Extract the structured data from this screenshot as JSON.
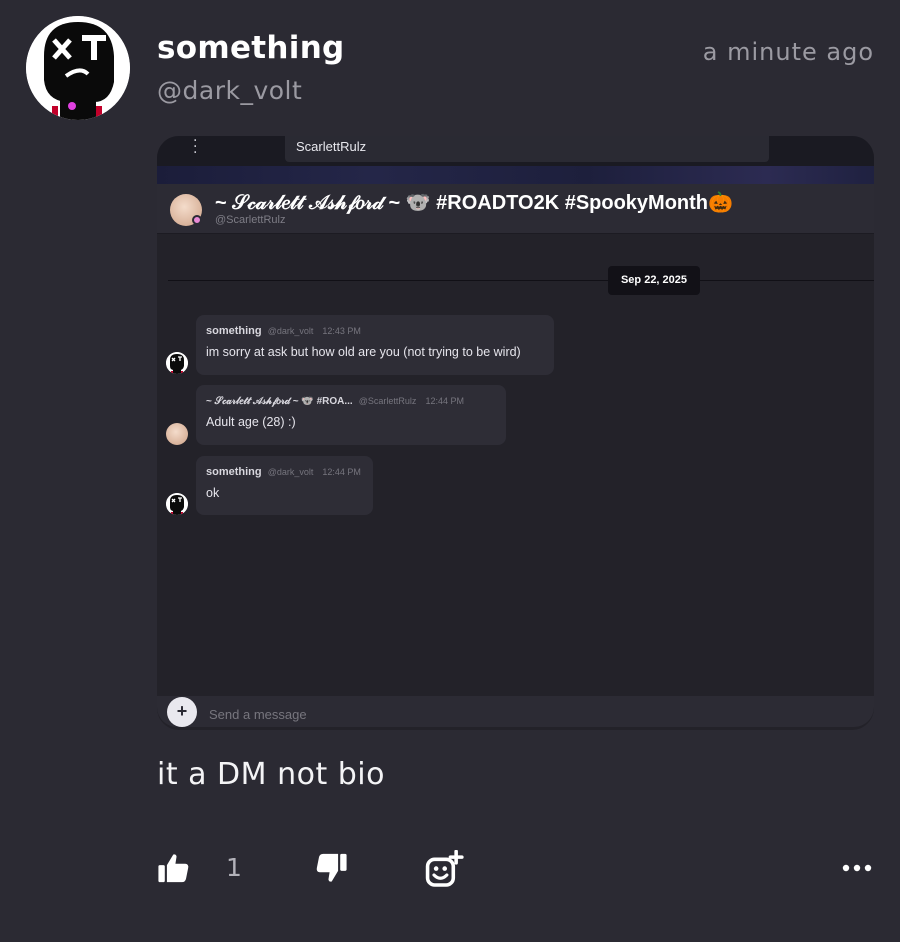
{
  "post": {
    "username": "something",
    "handle": "@dark_volt",
    "timestamp": "a minute ago",
    "body": "it a DM not bio",
    "like_count": "1"
  },
  "screenshot": {
    "tab_title": "ScarlettRulz",
    "header": {
      "name": "~ 𝒮𝒸𝒶𝓇𝓁𝑒𝓉𝓉 𝒜𝓈𝒽𝒻𝑜𝓇𝒹 ~ 🐨 #ROADTO2K #SpookyMonth🎃",
      "handle": "@ScarlettRulz"
    },
    "date_divider": "Sep 22, 2025",
    "messages": [
      {
        "author": "something",
        "handle": "@dark_volt",
        "time": "12:43 PM",
        "text": "im sorry at ask but how old are you (not trying to be wird)"
      },
      {
        "author": "~ 𝒮𝒸𝒶𝓇𝓁𝑒𝓉𝓉 𝒜𝓈𝒽𝒻𝑜𝓇𝒹 ~ 🐨 #ROA...",
        "handle": "@ScarlettRulz",
        "time": "12:44 PM",
        "text": "Adult age (28) :)"
      },
      {
        "author": "something",
        "handle": "@dark_volt",
        "time": "12:44 PM",
        "text": "ok"
      }
    ],
    "input_placeholder": "Send a message",
    "plus_label": "+"
  },
  "icons": {
    "like": "thumbs-up-icon",
    "dislike": "thumbs-down-icon",
    "react": "add-reaction-icon",
    "more": "more-options-icon"
  }
}
